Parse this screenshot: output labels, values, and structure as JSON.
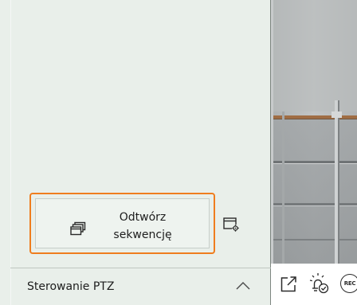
{
  "sequence": {
    "label_line1": "Odtwórz",
    "label_line2": "sekwencję"
  },
  "ptz": {
    "label": "Sterowanie PTZ"
  },
  "toolbar": {
    "rec_label": "REC"
  },
  "colors": {
    "panel_bg": "#e9efea",
    "focus_outline": "#ef7d1e",
    "text": "#1d1d1d"
  },
  "icons": {
    "sequence": "sequence-icon",
    "sequence_settings": "sequence-settings-icon",
    "ptz_toggle": "chevron-up-icon",
    "popout": "popout-icon",
    "alarm": "alarm-check-icon",
    "record": "record-icon"
  }
}
